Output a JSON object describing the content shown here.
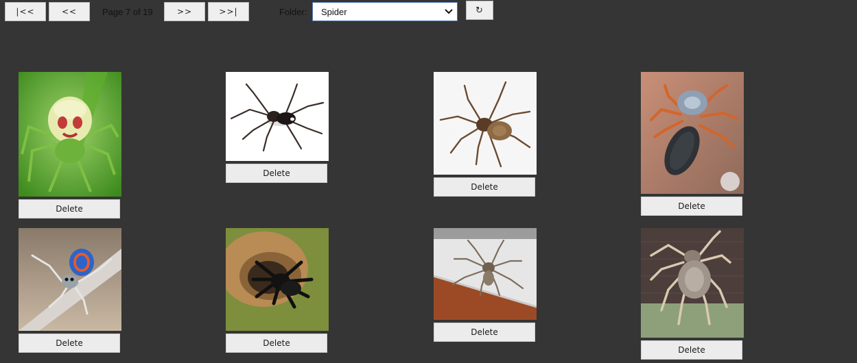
{
  "pager": {
    "first_label": "|<<",
    "prev_label": "<<",
    "page_text": "Page 7 of 19",
    "next_label": ">>",
    "last_label": ">>|"
  },
  "folder": {
    "label": "Folder:",
    "selected": "Spider",
    "refresh_icon": "↻"
  },
  "gallery": {
    "items": [
      {
        "subject": "green crab spider",
        "delete_label": "Delete"
      },
      {
        "subject": "white-tailed spider",
        "delete_label": "Delete"
      },
      {
        "subject": "wolf spider",
        "delete_label": "Delete"
      },
      {
        "subject": "orange-legged spider",
        "delete_label": "Delete"
      },
      {
        "subject": "peacock spider",
        "delete_label": "Delete"
      },
      {
        "subject": "black tarantula at burrow",
        "delete_label": "Delete"
      },
      {
        "subject": "huntsman spider on wall",
        "delete_label": "Delete"
      },
      {
        "subject": "garden orb-weaver spider",
        "delete_label": "Delete"
      }
    ]
  }
}
